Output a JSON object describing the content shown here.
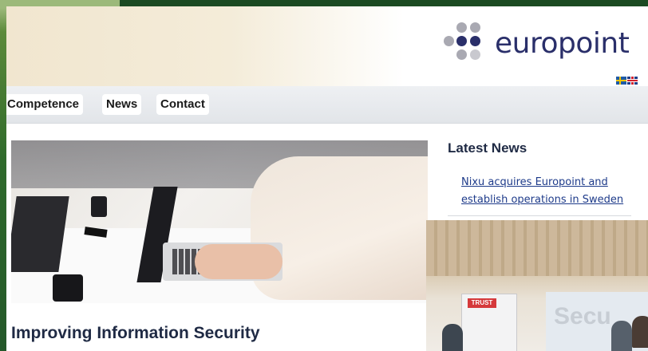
{
  "site": {
    "brand": "europoint",
    "colors": {
      "brand": "#2a2f6a",
      "link": "#1e3b8a",
      "heading": "#1f2a44"
    }
  },
  "language_flags": [
    {
      "name": "swedish-flag-icon"
    },
    {
      "name": "english-flag-icon"
    }
  ],
  "nav": {
    "items": [
      {
        "label": "Competence"
      },
      {
        "label": "News"
      },
      {
        "label": "Contact"
      }
    ]
  },
  "main": {
    "title": "Improving Information Security"
  },
  "sidebar": {
    "title": "Latest News",
    "news_link": "Nixu acquires Europoint and establish operations in Sweden",
    "photo_banner_text": "Secu",
    "photo_sign_text": "TRUST"
  }
}
